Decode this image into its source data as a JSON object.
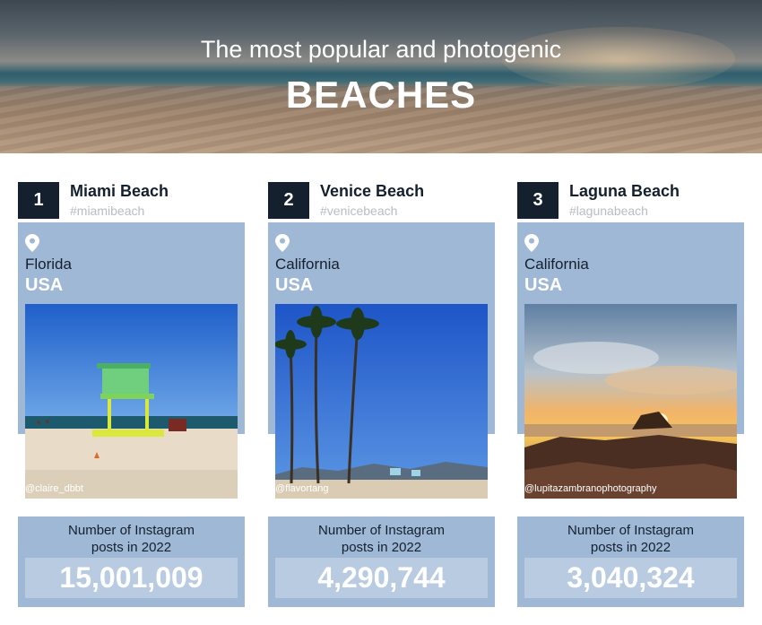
{
  "header": {
    "subtitle": "The most popular and photogenic",
    "title": "BEACHES"
  },
  "stat_label_line1": "Number of Instagram",
  "stat_label_line2": "posts in 2022",
  "beaches": [
    {
      "rank": "1",
      "name": "Miami Beach",
      "hashtag": "#miamibeach",
      "state": "Florida",
      "country": "USA",
      "credit": "@claire_dbbt",
      "posts": "15,001,009"
    },
    {
      "rank": "2",
      "name": "Venice Beach",
      "hashtag": "#venicebeach",
      "state": "California",
      "country": "USA",
      "credit": "@flavortang",
      "posts": "4,290,744"
    },
    {
      "rank": "3",
      "name": "Laguna Beach",
      "hashtag": "#lagunabeach",
      "state": "California",
      "country": "USA",
      "credit": "@lupitazambranophotography",
      "posts": "3,040,324"
    }
  ],
  "colors": {
    "dark": "#14202e",
    "panel": "#9fb8d6",
    "stat_box": "#b8cbe1"
  },
  "icons": {
    "location": "location-pin-icon"
  }
}
